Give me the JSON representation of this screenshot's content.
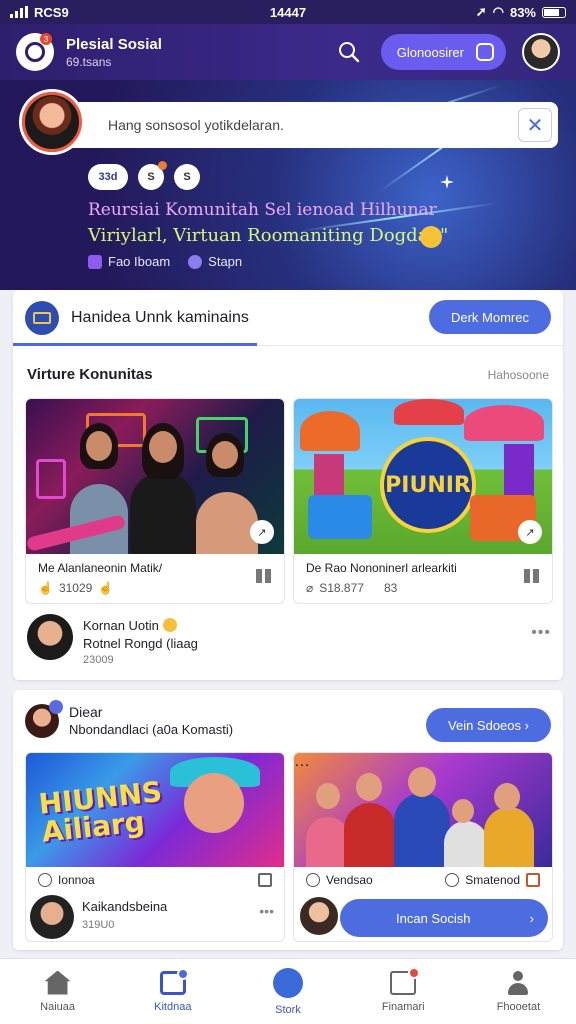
{
  "status_bar": {
    "carrier": "RCS9",
    "time": "14447",
    "battery": "83%"
  },
  "app_bar": {
    "brand_title": "Plesial Sosial",
    "brand_subtitle": "69.tsans",
    "pill_label": "Glonoosirer"
  },
  "hero": {
    "prompt_placeholder": "Hang sonsosol yotikdelaran.",
    "chips": [
      "33d",
      "S",
      "S"
    ],
    "title_line1": "Reursiai Komunitah Sel ienoad Hilhunar",
    "title_line2": "Viriylarl, Virtuan Roomaniting Dogdan\"",
    "meta_left": "Fao Iboam",
    "meta_right": "Stapn"
  },
  "card1": {
    "header_label": "Hanidea Unnk kaminains",
    "header_button": "Derk Momrec",
    "section_title": "Virture Konunitas",
    "section_link": "Hahosoone",
    "tiles": [
      {
        "title": "Me Alanlaneonin Matik/",
        "meta": "31029"
      },
      {
        "title": "De Rao Nononinerl arlearkiti",
        "meta": "S18.877",
        "meta2": "83"
      }
    ],
    "game_logo_text": "PIUNIR",
    "profile": {
      "name": "Kornan Uotin",
      "subtitle": "Rotnel Rongd (liaag",
      "time": "23009"
    }
  },
  "card2": {
    "title": "Diear",
    "subtitle": "Nbondandlaci (a0a Komasti)",
    "button": "Vein Sdoeos",
    "tiles": [
      {
        "hero_text": "HIUNNS Ailiarg",
        "foot_left": "Ionnoa",
        "profile_name": "Kaikandsbeina",
        "profile_sub": "319U0"
      },
      {
        "foot_left": "Vendsao",
        "foot_right": "Smatenod",
        "join_label": "Incan Socish"
      }
    ]
  },
  "bottom_nav": [
    {
      "label": "Naiuaa",
      "icon": "home-icon"
    },
    {
      "label": "Kitdnaa",
      "icon": "cards-icon"
    },
    {
      "label": "Stork",
      "icon": "play-icon"
    },
    {
      "label": "Finamari",
      "icon": "inbox-icon"
    },
    {
      "label": "Fhooetat",
      "icon": "user-icon"
    }
  ]
}
